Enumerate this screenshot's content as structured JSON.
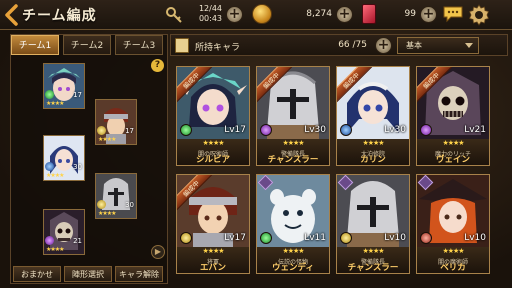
{
  "header": {
    "title": "チーム編成",
    "date": "12/44",
    "time": "00:43",
    "money": "8,274",
    "gems": "99"
  },
  "tabs": [
    "チーム1",
    "チーム2",
    "チーム3"
  ],
  "team_units": [
    {
      "level": "17",
      "stars": "★★★★",
      "element": "green"
    },
    {
      "level": "17",
      "stars": "★★★★",
      "element": "yellow"
    },
    {
      "level": "30",
      "stars": "★★★★",
      "element": "blue"
    },
    {
      "level": "30",
      "stars": "★★★★",
      "element": "yellow"
    },
    {
      "level": "21",
      "stars": "★★★★",
      "element": "purple"
    }
  ],
  "bottom_buttons": [
    "おまかせ",
    "陣形選択",
    "キャラ解除"
  ],
  "owned": {
    "label": "所持キャラ",
    "count": "66 /75",
    "sort": "基本"
  },
  "cards": [
    {
      "ribbon": "編成中",
      "level": "Lv17",
      "stars": "★★★★",
      "job": "闇の呪術師",
      "name": "シルビア",
      "element": "green"
    },
    {
      "ribbon": "編成中",
      "level": "Lv30",
      "stars": "★★★★",
      "job": "警備隊長",
      "name": "チャンスラー",
      "element": "purple"
    },
    {
      "ribbon": "編成中",
      "level": "Lv30",
      "stars": "★★★★",
      "job": "大泊修院",
      "name": "カリン",
      "element": "blue"
    },
    {
      "ribbon": "編成中",
      "level": "Lv21",
      "stars": "★★★★",
      "job": "魔力のリッチ",
      "name": "ヴェイン",
      "element": "purple"
    },
    {
      "ribbon": "編成中",
      "level": "Lv17",
      "stars": "★★★★",
      "job": "将軍",
      "name": "エバン",
      "element": "yellow"
    },
    {
      "ribbon": "",
      "level": "Lv11",
      "stars": "★★★★",
      "job": "伝説の怪物",
      "name": "ウェンディ",
      "element": "green"
    },
    {
      "ribbon": "",
      "level": "Lv10",
      "stars": "★★★★",
      "job": "警備隊長",
      "name": "チャンスラー",
      "element": "yellow"
    },
    {
      "ribbon": "",
      "level": "Lv10",
      "stars": "★★★★",
      "job": "闇の魔術師",
      "name": "ベリカ",
      "element": "red"
    }
  ]
}
